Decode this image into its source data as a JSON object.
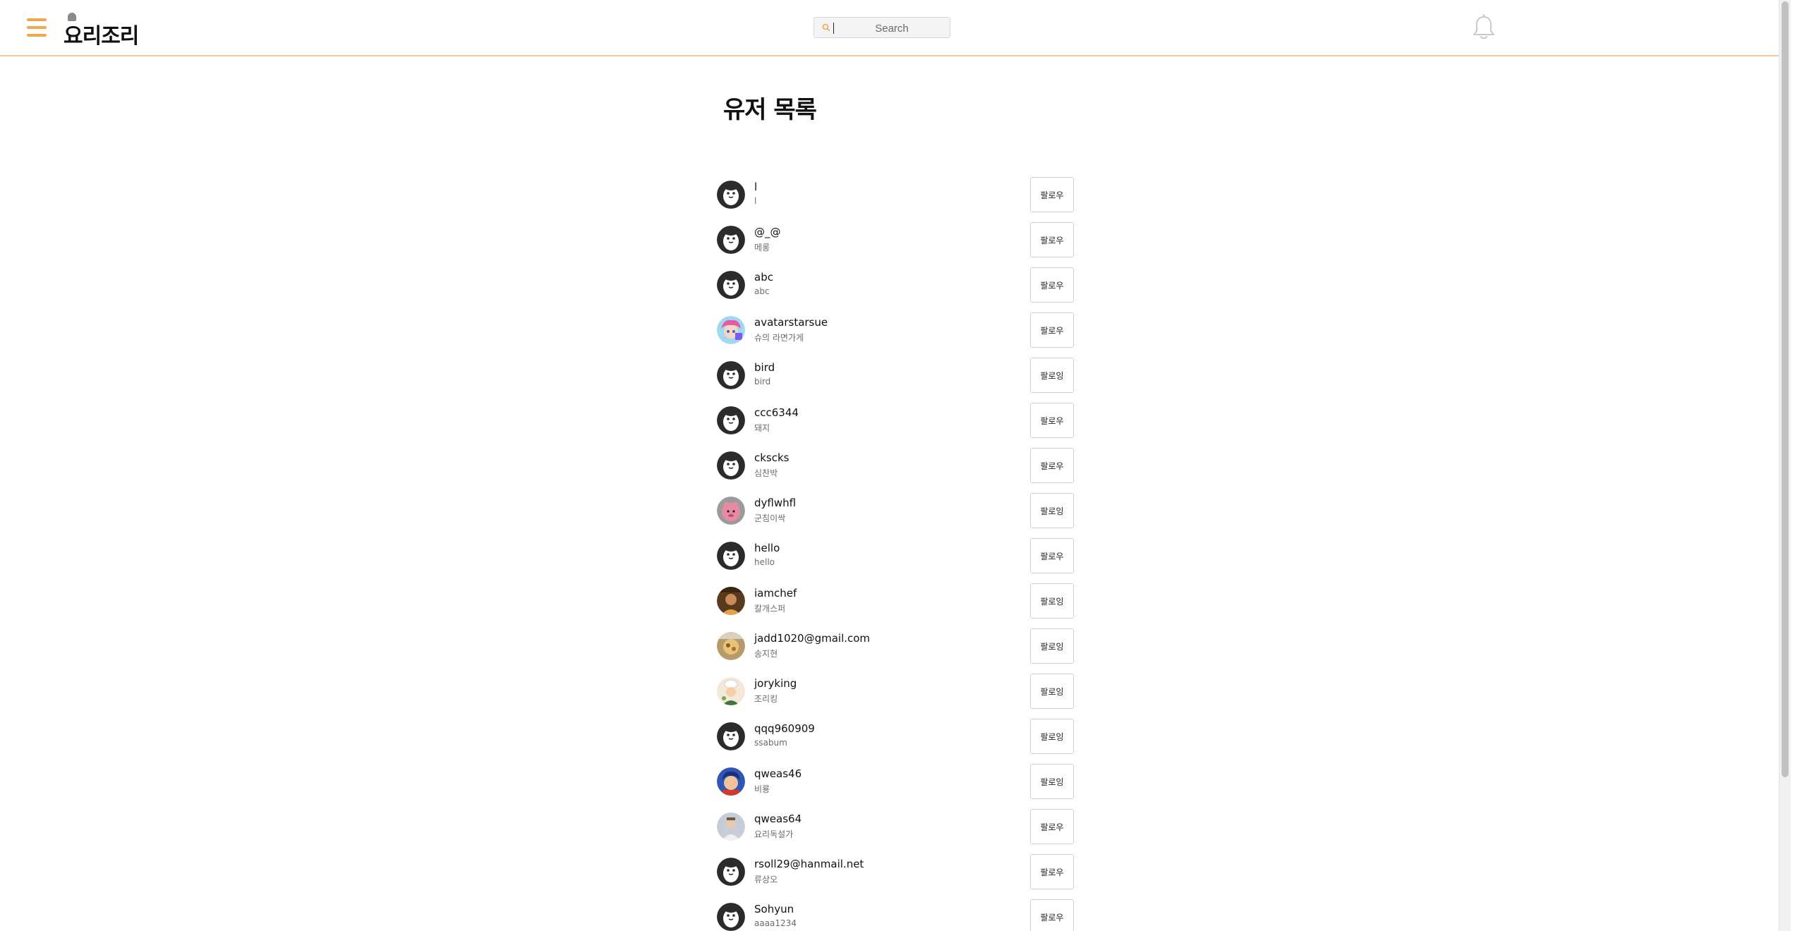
{
  "header": {
    "logo_text": "요리조리",
    "search_placeholder": "Search",
    "search_value": ""
  },
  "page_title": "유저 목록",
  "users": [
    {
      "name": "l",
      "sub": "l",
      "button": "팔로우",
      "avatar": "default"
    },
    {
      "name": "@_@",
      "sub": "메롱",
      "button": "팔로우",
      "avatar": "default"
    },
    {
      "name": "abc",
      "sub": "abc",
      "button": "팔로우",
      "avatar": "default"
    },
    {
      "name": "avatarstarsue",
      "sub": "슈의 라면가게",
      "button": "팔로우",
      "avatar": "anime"
    },
    {
      "name": "bird",
      "sub": "bird",
      "button": "팔로잉",
      "avatar": "default"
    },
    {
      "name": "ccc6344",
      "sub": "돼지",
      "button": "팔로우",
      "avatar": "default"
    },
    {
      "name": "ckscks",
      "sub": "심찬박",
      "button": "팔로우",
      "avatar": "default"
    },
    {
      "name": "dyflwhfl",
      "sub": "군침이싹",
      "button": "팔로잉",
      "avatar": "pink-character"
    },
    {
      "name": "hello",
      "sub": "hello",
      "button": "팔로우",
      "avatar": "default"
    },
    {
      "name": "iamchef",
      "sub": "칼개스퍼",
      "button": "팔로잉",
      "avatar": "photo-man"
    },
    {
      "name": "jadd1020@gmail.com",
      "sub": "송지현",
      "button": "팔로잉",
      "avatar": "photo-food"
    },
    {
      "name": "joryking",
      "sub": "조리킹",
      "button": "팔로잉",
      "avatar": "cartoon-chef"
    },
    {
      "name": "qqq960909",
      "sub": "ssabum",
      "button": "팔로잉",
      "avatar": "default"
    },
    {
      "name": "qweas46",
      "sub": "비룡",
      "button": "팔로잉",
      "avatar": "cartoon-blue"
    },
    {
      "name": "qweas64",
      "sub": "요리독설가",
      "button": "팔로우",
      "avatar": "photo-person"
    },
    {
      "name": "rsoll29@hanmail.net",
      "sub": "류상오",
      "button": "팔로우",
      "avatar": "default"
    },
    {
      "name": "Sohyun",
      "sub": "aaaa1234",
      "button": "팔로우",
      "avatar": "default"
    }
  ],
  "colors": {
    "accent": "#f4a64f",
    "header_border": "#f7c89c",
    "default_avatar": "#2b2b2b"
  },
  "icons": {
    "menu": "hamburger-icon",
    "search": "search-icon",
    "notifications": "bell-icon",
    "default_avatar": "penguin-avatar-icon"
  }
}
